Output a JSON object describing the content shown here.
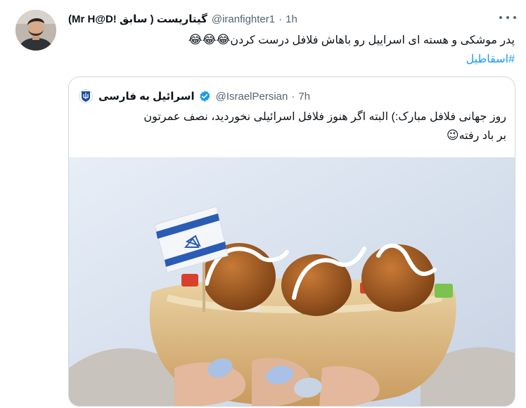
{
  "tweet": {
    "display_name": "گیتاریست ( سابق !Mr H@D)",
    "handle": "@iranfighter1",
    "separator": "·",
    "time": "1h",
    "text": "پدر موشکی و هسته ای اسراییل رو باهاش فلافل درست کردن",
    "text_emoji": "😂😂😂",
    "hashtag": "#اسقاطیل",
    "more_icon": "more-horizontal-icon"
  },
  "quote": {
    "display_name": "اسرائیل به فارسی",
    "handle": "@IsraelPersian",
    "separator": "·",
    "time": "7h",
    "text_line1": "روز جهانی فلافل مبارک:) البته اگر هنوز فلافل اسرائیلی نخوردید، نصف عمرتون",
    "text_line2": "بر باد رفته",
    "text_emoji": "😉",
    "verified_icon": "verified-badge-icon",
    "avatar_icon": "israel-emblem-icon",
    "image": "falafel-pita-with-israeli-flag"
  },
  "colors": {
    "text": "#0f1419",
    "secondary": "#536471",
    "link": "#1d9bf0",
    "border": "#cfd9de",
    "flag_blue": "#2a5bb5"
  }
}
